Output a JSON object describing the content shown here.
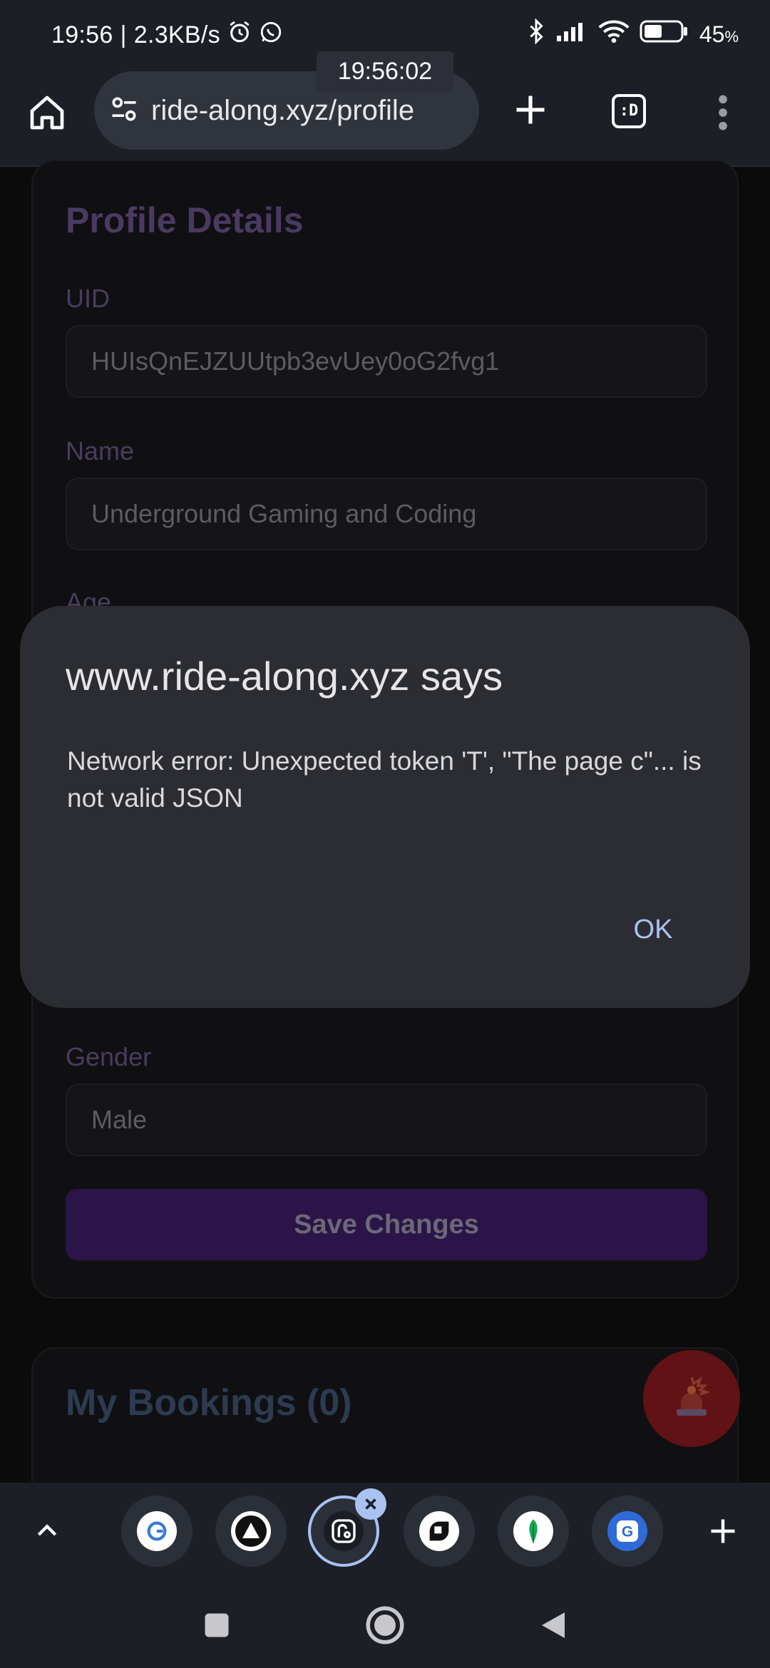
{
  "status_bar": {
    "time": "19:56",
    "separator": "|",
    "net_speed": "2.3KB/s",
    "battery": "45",
    "battery_unit": "%",
    "icons": [
      "alarm-icon",
      "whatsapp-icon",
      "bluetooth-icon",
      "signal-icon",
      "wifi-icon",
      "battery-icon"
    ]
  },
  "time_tooltip": "19:56:02",
  "browser": {
    "url": "ride-along.xyz/profile",
    "tabs_label": ":D"
  },
  "profile": {
    "title": "Profile Details",
    "uid_label": "UID",
    "uid_value": "HUIsQnEJZUUtpb3evUey0oG2fvg1",
    "name_label": "Name",
    "name_value": "Underground Gaming and Coding",
    "age_label": "Age",
    "gender_label": "Gender",
    "gender_value": "Male",
    "save_label": "Save Changes"
  },
  "bookings": {
    "title": "My Bookings (0)"
  },
  "dialog": {
    "title": "www.ride-along.xyz says",
    "message": "Network error: Unexpected token 'T', \"The page c\"... is not valid JSON",
    "ok_label": "OK"
  },
  "colors": {
    "accent": "#a9c2f2",
    "save_button": "#2a1448",
    "sos": "#611214"
  }
}
